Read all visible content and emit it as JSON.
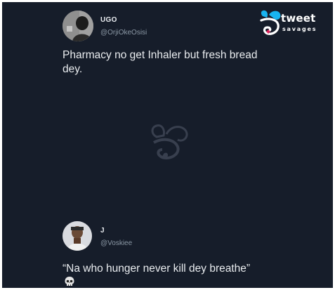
{
  "brand": {
    "word": "tweet",
    "sub": "savages",
    "icon": "tweet-savages-logo",
    "color": "#18b4f0"
  },
  "tweets": [
    {
      "name": "UGO",
      "handle": "@OrjiOkeOsisi",
      "text_line1": "Pharmacy no get Inhaler but fresh bread",
      "text_line2": "dey."
    },
    {
      "name": "J",
      "handle": "@Voskiee",
      "text_line1": "“Na who hunger never kill dey breathe”",
      "emoji": "💀"
    }
  ],
  "colors": {
    "background": "#161d2a",
    "text": "#e9ecef",
    "handle": "#8b98a5"
  }
}
